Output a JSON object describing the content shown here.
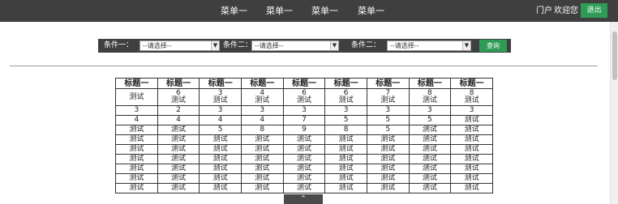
{
  "nav": {
    "menus": [
      "菜单一",
      "菜单一",
      "菜单一",
      "菜单一"
    ],
    "portal": "门户",
    "welcome": "欢迎您",
    "exit_label": "退出"
  },
  "filters": {
    "cond1_label": "条件一：",
    "cond2_label": "条件二：",
    "cond3_label": "条件二：",
    "select_value": "--请选择--",
    "query_label": "查询"
  },
  "table": {
    "headers": [
      "标题一",
      "标题一",
      "标题一",
      "标题一",
      "标题一",
      "标题一",
      "标题一",
      "标题一",
      "标题一"
    ],
    "rows": [
      [
        "测试",
        "6\n测试",
        "3\n测试",
        "4\n测试",
        "6\n测试",
        "6\n测试",
        "7\n测试",
        "8\n测试",
        "8\n测试"
      ],
      [
        "3",
        "2",
        "3",
        "3",
        "3",
        "3",
        "3",
        "3",
        "3"
      ],
      [
        "4",
        "4",
        "4",
        "4",
        "7",
        "5",
        "5",
        "5",
        "测试"
      ],
      [
        "测试",
        "测试",
        "5",
        "8",
        "9",
        "8",
        "5",
        "测试",
        "测试"
      ],
      [
        "测试",
        "测试",
        "测试",
        "测试",
        "测试",
        "测试",
        "测试",
        "测试",
        "测试"
      ],
      [
        "测试",
        "测试",
        "测试",
        "测试",
        "测试",
        "测试",
        "测试",
        "测试",
        "测试"
      ],
      [
        "测试",
        "测试",
        "测试",
        "测试",
        "测试",
        "测试",
        "测试",
        "测试",
        "测试"
      ],
      [
        "测试",
        "测试",
        "测试",
        "测试",
        "测试",
        "测试",
        "测试",
        "测试",
        "测试"
      ],
      [
        "测试",
        "测试",
        "测试",
        "测试",
        "测试",
        "测试",
        "测试",
        "测试",
        "测试"
      ],
      [
        "测试",
        "测试",
        "测试",
        "测试",
        "测试",
        "测试",
        "测试",
        "测试",
        "测试"
      ]
    ]
  },
  "back_to_top": "⌃",
  "colors": {
    "topbar": "#3f3f3f",
    "accent_green": "#2e9c56"
  }
}
